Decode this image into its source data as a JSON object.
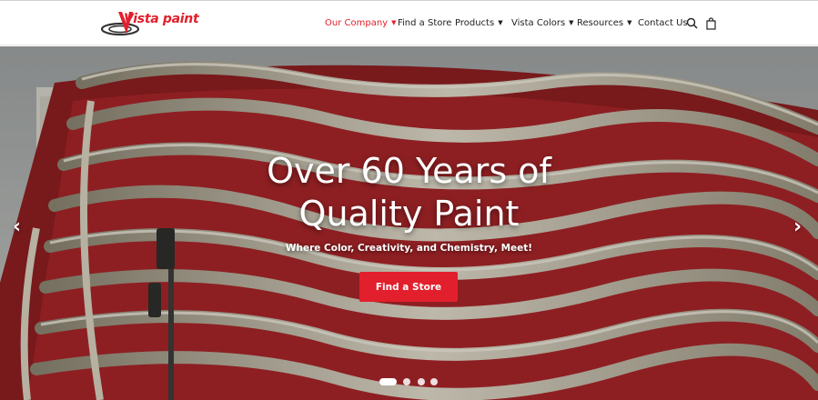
{
  "brand": {
    "logo_text": "Vista paint",
    "accent_color": "#e21f2c"
  },
  "nav": {
    "items": [
      {
        "label": "Our Company",
        "has_caret": true,
        "active": true
      },
      {
        "label": "Find a Store",
        "has_caret": false,
        "active": false
      },
      {
        "label": "Products",
        "has_caret": true,
        "active": false
      },
      {
        "label": "Vista Colors",
        "has_caret": true,
        "active": false
      },
      {
        "label": "Resources",
        "has_caret": true,
        "active": false
      },
      {
        "label": "Contact Us",
        "has_caret": false,
        "active": false
      }
    ],
    "icons": [
      "search-icon",
      "shopping-bag-icon"
    ],
    "caret_glyph": "▼"
  },
  "hero": {
    "title_line1": "Over 60 Years of",
    "title_line2": "Quality Paint",
    "subtitle": "Where Color, Creativity, and Chemistry, Meet!",
    "cta_label": "Find a Store",
    "prev_glyph": "‹",
    "next_glyph": "›",
    "slide_count": 4,
    "active_slide": 1
  }
}
